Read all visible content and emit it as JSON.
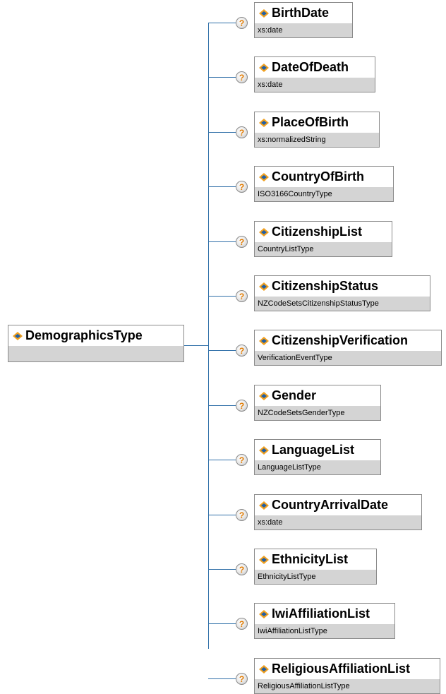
{
  "root": {
    "name": "DemographicsType",
    "type": ""
  },
  "help_symbol": "?",
  "elements": [
    {
      "name": "BirthDate",
      "type": "xs:date"
    },
    {
      "name": "DateOfDeath",
      "type": "xs:date"
    },
    {
      "name": "PlaceOfBirth",
      "type": "xs:normalizedString"
    },
    {
      "name": "CountryOfBirth",
      "type": "ISO3166CountryType"
    },
    {
      "name": "CitizenshipList",
      "type": "CountryListType"
    },
    {
      "name": "CitizenshipStatus",
      "type": "NZCodeSetsCitizenshipStatusType"
    },
    {
      "name": "CitizenshipVerification",
      "type": "VerificationEventType"
    },
    {
      "name": "Gender",
      "type": "NZCodeSetsGenderType"
    },
    {
      "name": "LanguageList",
      "type": "LanguageListType"
    },
    {
      "name": "CountryArrivalDate",
      "type": "xs:date"
    },
    {
      "name": "EthnicityList",
      "type": "EthnicityListType"
    },
    {
      "name": "IwiAffiliationList",
      "type": "IwiAffiliationListType"
    },
    {
      "name": "ReligiousAffiliationList",
      "type": "ReligiousAffiliationListType"
    }
  ],
  "colors": {
    "connector": "#2f6fa8",
    "type_band": "#d4d4d4",
    "icon_orange": "#f0a020",
    "icon_blue": "#1f5fa8"
  }
}
